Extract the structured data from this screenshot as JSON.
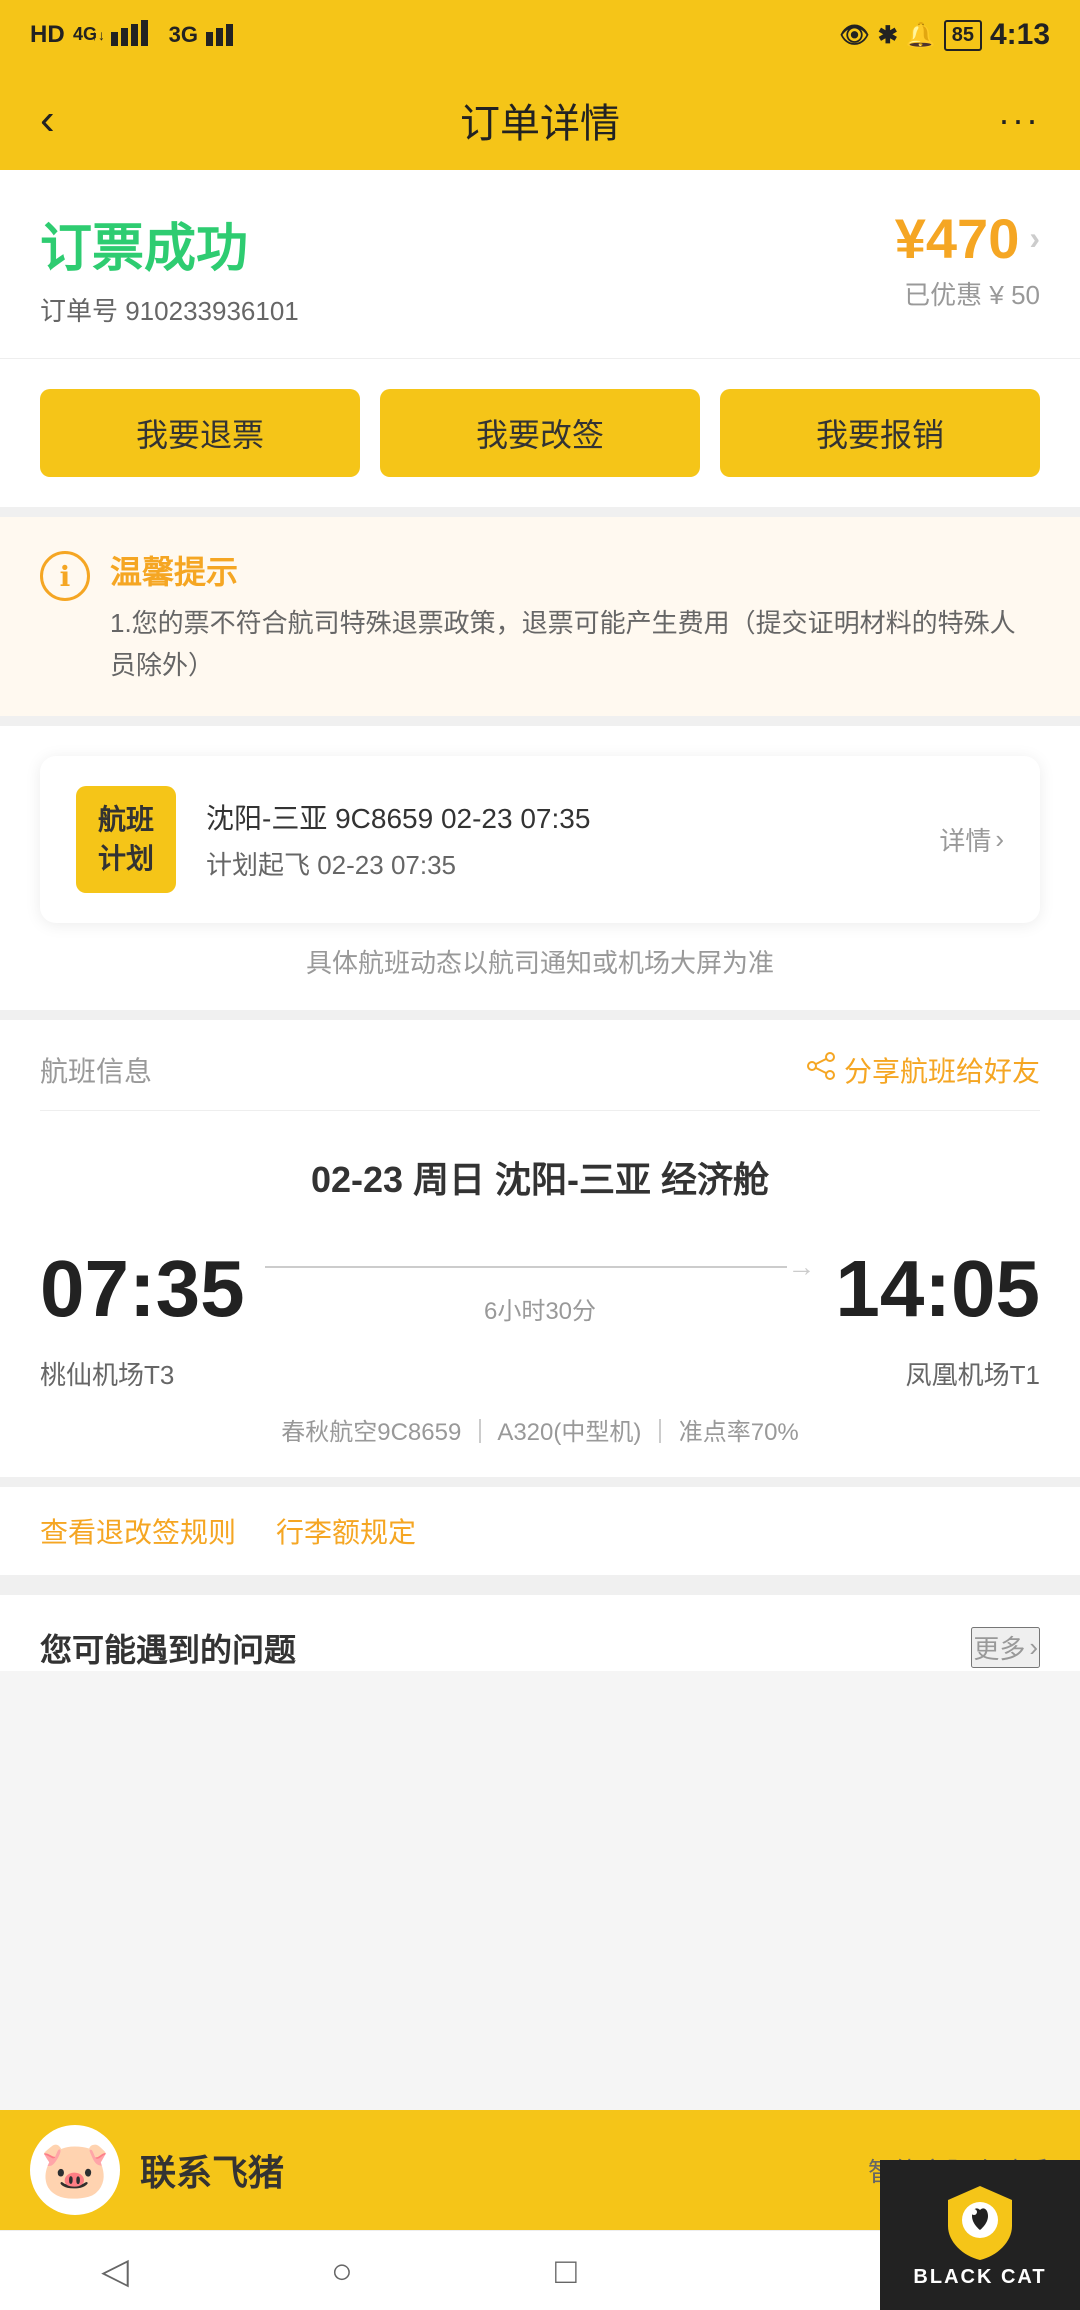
{
  "statusBar": {
    "leftIcons": "HD 4G 46 3G",
    "time": "4:13",
    "battery": "85"
  },
  "header": {
    "title": "订单详情",
    "backLabel": "‹",
    "moreLabel": "···"
  },
  "orderSuccess": {
    "successTitle": "订票成功",
    "price": "¥470",
    "priceSymbol": "¥",
    "priceValue": "470",
    "discountText": "已优惠 ¥ 50",
    "orderNumber": "订单号 910233936101"
  },
  "actionButtons": {
    "refundLabel": "我要退票",
    "changeLabel": "我要改签",
    "invoiceLabel": "我要报销"
  },
  "notice": {
    "title": "温馨提示",
    "text": "1.您的票不符合航司特殊退票政策，退票可能产生费用（提交证明材料的特殊人员除外）"
  },
  "flightPlan": {
    "badgeLine1": "航班",
    "badgeLine2": "计划",
    "route": "沈阳-三亚 9C8659 02-23 07:35",
    "scheduledTime": "计划起飞 02-23 07:35",
    "detailsLink": "详情",
    "flightNotice": "具体航班动态以航司通知或机场大屏为准"
  },
  "flightInfo": {
    "sectionLabel": "航班信息",
    "shareLabel": "分享航班给好友",
    "dateRoute": "02-23  周日  沈阳-三亚  经济舱",
    "departTime": "07:35",
    "arriveTime": "14:05",
    "duration": "6小时30分",
    "departAirport": "桃仙机场T3",
    "arriveAirport": "凤凰机场T1",
    "airline": "春秋航空9C8659",
    "plane": "A320(中型机)",
    "onTimeRate": "准点率70%"
  },
  "rules": {
    "refundRuleLabel": "查看退改签规则",
    "baggageLabel": "行李额规定"
  },
  "faq": {
    "title": "您可能遇到的问题",
    "moreLabel": "更多"
  },
  "contact": {
    "name": "联系飞猪",
    "subtitle": "智能客服小助手"
  },
  "bottomNav": {
    "back": "◁",
    "home": "○",
    "recent": "□"
  },
  "blackcat": {
    "text": "BLACK CAT"
  }
}
